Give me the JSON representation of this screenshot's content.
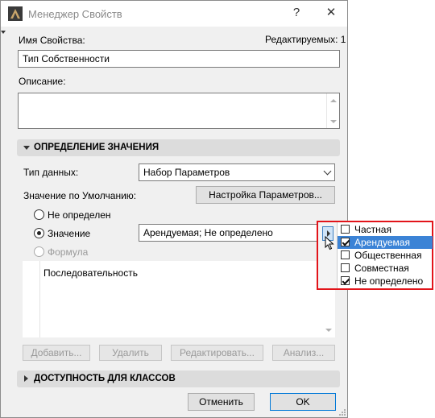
{
  "window": {
    "title": "Менеджер Свойств",
    "help": "?",
    "close": "✕"
  },
  "header": {
    "name_label": "Имя Свойства:",
    "editable_label": "Редактируемых: 1",
    "name_value": "Тип Собственности",
    "description_label": "Описание:",
    "description_value": ""
  },
  "value_section": {
    "title": "ОПРЕДЕЛЕНИЕ ЗНАЧЕНИЯ",
    "data_type_label": "Тип данных:",
    "data_type_value": "Набор Параметров",
    "default_label": "Значение по Умолчанию:",
    "setup_button": "Настройка Параметров...",
    "radio_undefined": "Не определен",
    "radio_value": "Значение",
    "radio_formula": "Формула",
    "value_field": "Арендуемая; Не определено",
    "sequence_label": "Последовательность",
    "buttons": {
      "add": "Добавить...",
      "delete": "Удалить",
      "edit": "Редактировать...",
      "analyze": "Анализ..."
    }
  },
  "classes_section": {
    "title": "ДОСТУПНОСТЬ ДЛЯ КЛАССОВ"
  },
  "footer": {
    "cancel": "Отменить",
    "ok": "OK"
  },
  "popup": {
    "options": [
      {
        "label": "Частная",
        "checked": false,
        "selected": false
      },
      {
        "label": "Арендуемая",
        "checked": true,
        "selected": true
      },
      {
        "label": "Общественная",
        "checked": false,
        "selected": false
      },
      {
        "label": "Совместная",
        "checked": false,
        "selected": false
      },
      {
        "label": "Не определено",
        "checked": true,
        "selected": false
      }
    ]
  },
  "colors": {
    "highlight": "#e2141a",
    "selection": "#3b83d6"
  },
  "icons": [
    "app-icon",
    "help-icon",
    "close-icon",
    "chevron-down-icon",
    "expand-arrow-icon",
    "collapse-arrow-icon",
    "checkbox-icon",
    "mouse-cursor-icon",
    "resize-grip-icon"
  ]
}
